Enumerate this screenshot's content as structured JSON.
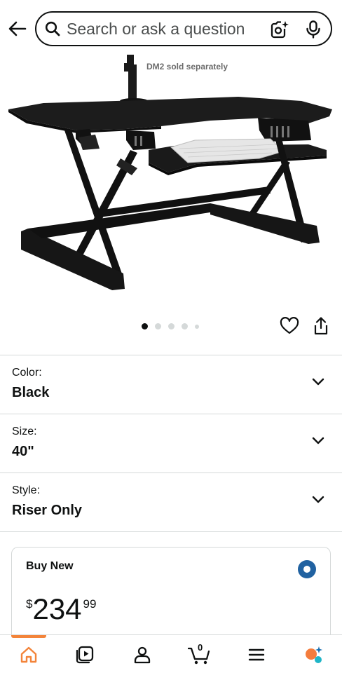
{
  "header": {
    "search_placeholder": "Search or ask a question"
  },
  "product": {
    "image_caption": "DM2 sold separately",
    "carousel": {
      "total_images": 5,
      "active_index": 0
    }
  },
  "variations": [
    {
      "label": "Color:",
      "value": "Black"
    },
    {
      "label": "Size:",
      "value": "40\""
    },
    {
      "label": "Style:",
      "value": "Riser Only"
    }
  ],
  "buy_box": {
    "title": "Buy New",
    "price_symbol": "$",
    "price_whole": "234",
    "price_fraction": "99",
    "selected": true
  },
  "bottom_nav": {
    "cart_count": "0",
    "active": "home"
  },
  "colors": {
    "accent_orange": "#f3843a",
    "radio_blue": "#2162a1",
    "text": "#0f1111",
    "divider": "#d5d9d9",
    "assistant_orange": "#f47c3c",
    "assistant_teal": "#1fb5c7"
  },
  "icons": {
    "back": "arrow-left-icon",
    "search": "search-icon",
    "camera": "camera-sparkle-icon",
    "mic": "microphone-icon",
    "heart": "heart-icon",
    "share": "share-icon",
    "chevron": "chevron-down-icon",
    "home": "home-icon",
    "video": "video-icon",
    "account": "account-icon",
    "cart": "cart-icon",
    "menu": "menu-icon",
    "assistant": "assistant-icon"
  }
}
